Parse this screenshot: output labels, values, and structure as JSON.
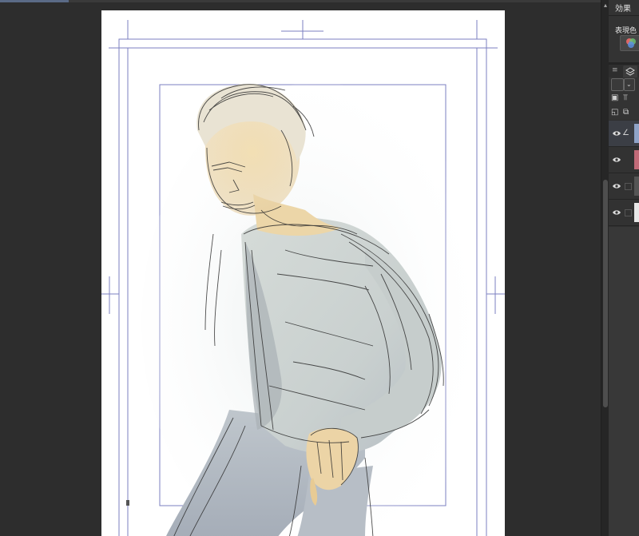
{
  "canvas": {
    "paper_color": "#ffffff",
    "background_color": "#2d2d2d",
    "guide_color": "#7b7fc1"
  },
  "right_panel": {
    "effect_title": "効果",
    "expression_label": "表現色",
    "color_button_icon": "color-wheel-icon",
    "tabs": [
      {
        "icon": "menu-icon"
      },
      {
        "icon": "layer-stack-icon"
      }
    ],
    "tools": [
      {
        "icon": "frame-icon"
      },
      {
        "icon": "dropdown-icon"
      },
      {
        "icon": "copy-layer-icon"
      },
      {
        "icon": "clip-icon"
      },
      {
        "icon": "new-layer-icon"
      },
      {
        "icon": "new-folder-icon"
      }
    ],
    "layers": [
      {
        "type": "vector-pen-icon",
        "thumb_color": "#8fa3c8",
        "active": true
      },
      {
        "type": "none",
        "thumb_color": "#c26a78",
        "active": false
      },
      {
        "type": "none",
        "thumb_color": "#555555",
        "active": false
      },
      {
        "type": "none",
        "thumb_color": "#e8e8e8",
        "active": false
      }
    ]
  }
}
